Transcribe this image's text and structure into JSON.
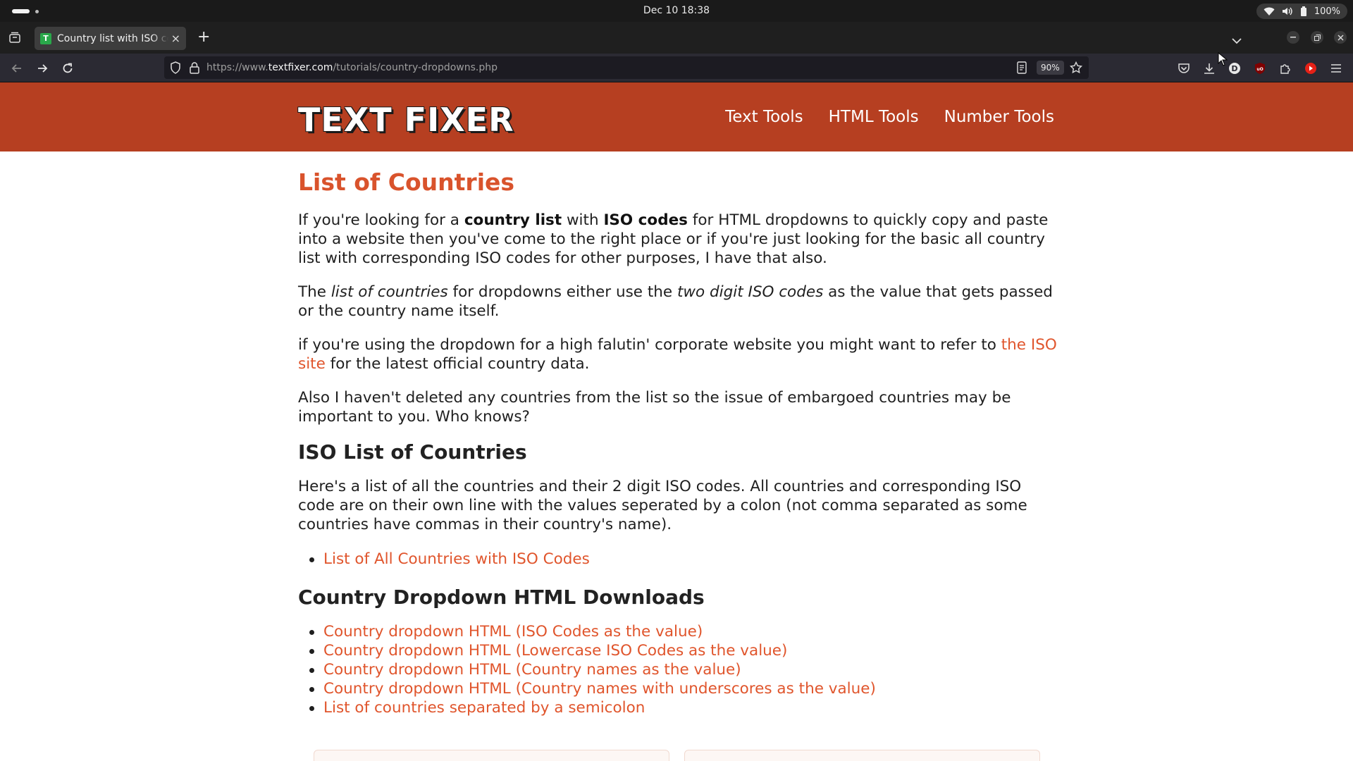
{
  "os": {
    "clock": "Dec 10  18:38",
    "battery": "100%"
  },
  "browser": {
    "tab_title": "Country list with ISO codes",
    "favicon_letter": "T",
    "new_tab_symbol": "+",
    "url_prefix": "https://www.",
    "url_host": "textfixer.com",
    "url_path": "/tutorials/country-dropdowns.php",
    "zoom": "90%"
  },
  "site": {
    "logo": "TEXT FIXER",
    "nav": [
      "Text Tools",
      "HTML Tools",
      "Number Tools"
    ]
  },
  "content": {
    "title": "List of Countries",
    "p1": {
      "a": "If you're looking for a ",
      "b1": "country list",
      "c": " with ",
      "b2": "ISO codes",
      "d": " for HTML dropdowns to quickly copy and paste into a website then you've come to the right place or if you're just looking for the basic all country list with corresponding ISO codes for other purposes, I have that also."
    },
    "p2": {
      "a": "The ",
      "i1": "list of countries",
      "b": " for dropdowns either use the ",
      "i2": "two digit ISO codes",
      "c": " as the value that gets passed or the country name itself."
    },
    "p3": {
      "a": "if you're using the dropdown for a high falutin' corporate website you might want to refer to ",
      "link": "the ISO site",
      "b": " for the latest official country data."
    },
    "p4": "Also I haven't deleted any countries from the list so the issue of embargoed countries may be important to you. Who knows?",
    "h2_iso": "ISO List of Countries",
    "p5": "Here's a list of all the countries and their 2 digit ISO codes. All countries and corresponding ISO code are on their own line with the values seperated by a colon (not comma separated as some countries have commas in their country's name).",
    "iso_links": [
      "List of All Countries with ISO Codes"
    ],
    "h2_downloads": "Country Dropdown HTML Downloads",
    "download_links": [
      "Country dropdown HTML (ISO Codes as the value)",
      "Country dropdown HTML (Lowercase ISO Codes as the value)",
      "Country dropdown HTML (Country names as the value)",
      "Country dropdown HTML (Country names with underscores as the value)",
      "List of countries separated by a semicolon"
    ]
  },
  "colors": {
    "header_bg": "#b63f21",
    "accent": "#e0552c",
    "title": "#d9532c"
  }
}
